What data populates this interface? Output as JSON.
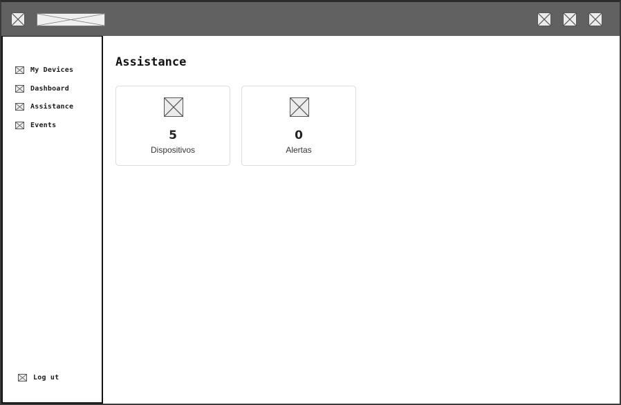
{
  "topbar": {
    "menu_icon": "image-placeholder-icon",
    "logo": "image-placeholder",
    "actions": [
      "image-placeholder-icon",
      "image-placeholder-icon",
      "image-placeholder-icon"
    ],
    "background_color": "#616161"
  },
  "sidebar": {
    "items": [
      {
        "label": "My Devices",
        "icon": "image-placeholder-icon"
      },
      {
        "label": "Dashboard",
        "icon": "image-placeholder-icon"
      },
      {
        "label": "Assistance",
        "icon": "image-placeholder-icon"
      },
      {
        "label": "Events",
        "icon": "image-placeholder-icon"
      }
    ],
    "logout_label": "Log ut"
  },
  "main": {
    "title": "Assistance",
    "cards": [
      {
        "value": "5",
        "label": "Dispositivos",
        "icon": "image-placeholder-icon"
      },
      {
        "value": "0",
        "label": "Alertas",
        "icon": "image-placeholder-icon"
      }
    ]
  }
}
